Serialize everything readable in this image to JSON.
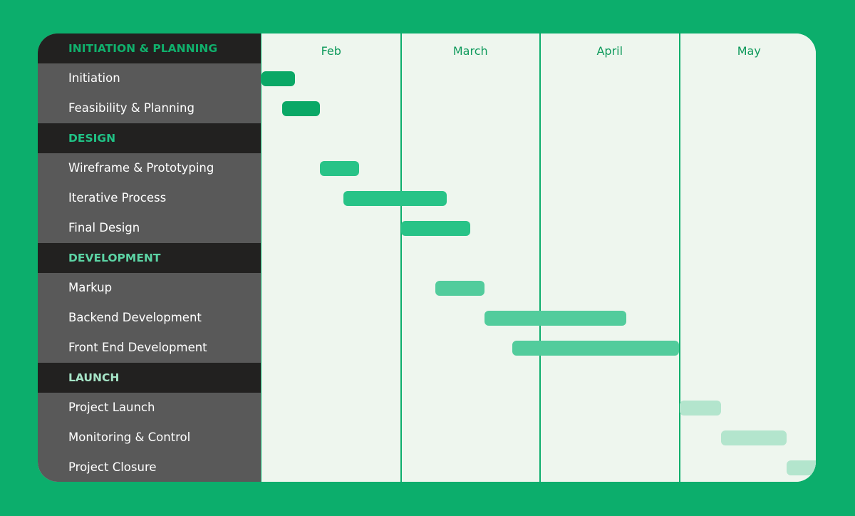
{
  "colors": {
    "page_background": "#0cae6c",
    "timeline_background": "#eef6ee",
    "sidebar_task_background": "#595959",
    "sidebar_section_background": "#222120",
    "month_label": "#0f9a5c"
  },
  "months": [
    "Feb",
    "March",
    "April",
    "May"
  ],
  "phases": [
    {
      "name": "INITIATION & PLANNING",
      "label_color": "#10b06c",
      "bar_color": "#0aa866",
      "tasks": [
        {
          "name": "Initiation",
          "start": 0.0,
          "end": 0.24
        },
        {
          "name": "Feasibility & Planning",
          "start": 0.15,
          "end": 0.42
        }
      ]
    },
    {
      "name": "DESIGN",
      "label_color": "#20c285",
      "bar_color": "#28c387",
      "tasks": [
        {
          "name": "Wireframe & Prototyping",
          "start": 0.42,
          "end": 0.7
        },
        {
          "name": "Iterative Process",
          "start": 0.59,
          "end": 1.33
        },
        {
          "name": "Final Design",
          "start": 1.0,
          "end": 1.5
        }
      ]
    },
    {
      "name": "DEVELOPMENT",
      "label_color": "#5cd3a4",
      "bar_color": "#52cc9c",
      "tasks": [
        {
          "name": "Markup",
          "start": 1.25,
          "end": 1.6
        },
        {
          "name": "Backend Development",
          "start": 1.6,
          "end": 2.62
        },
        {
          "name": "Front End Development",
          "start": 1.8,
          "end": 3.0
        }
      ]
    },
    {
      "name": "LAUNCH",
      "label_color": "#a6e4c7",
      "bar_color": "#b3e5cd",
      "tasks": [
        {
          "name": "Project Launch",
          "start": 3.0,
          "end": 3.3
        },
        {
          "name": "Monitoring & Control",
          "start": 3.3,
          "end": 3.77
        },
        {
          "name": "Project Closure",
          "start": 3.77,
          "end": 4.05
        }
      ]
    }
  ]
}
